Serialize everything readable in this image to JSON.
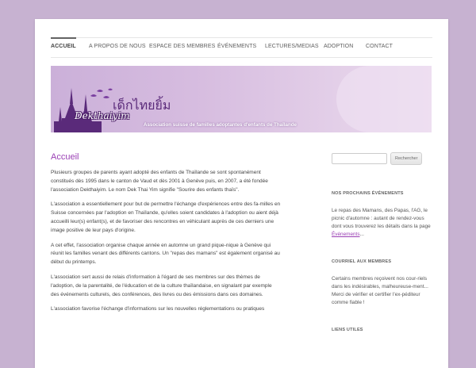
{
  "nav": {
    "items": [
      {
        "label": "ACCUEIL",
        "active": true
      },
      {
        "label": "A PROPOS DE NOUS"
      },
      {
        "label": "ESPACE DES MEMBRES"
      },
      {
        "label": "ÉVÉNEMENTS"
      },
      {
        "label": "LECTURES/MEDIAS"
      },
      {
        "label": "ADOPTION"
      },
      {
        "label": "CONTACT"
      }
    ]
  },
  "banner": {
    "logo_thai": "เด็กไทยยิ้ม",
    "logo_latin": "Dekthaiyim",
    "tagline": "Association suisse de familles adoptantes d'enfants de Thaïlande"
  },
  "main": {
    "title": "Accueil",
    "paragraphs": [
      "Plusieurs groupes de parents ayant adopté des enfants de Thaïlande se sont spontanément constitués dès 1995 dans le canton de Vaud et dès 2001 à Genève puis, en 2007, a été fondée l'association Dekthaiyim. Le nom Dek Thai Yim signifie \"Sourire des enfants thaïs\".",
      "L'association a essentiellement pour but de permettre l'échange d'expériences entre des fa-milles en Suisse concernées par l'adoption en Thaïlande, qu'elles soient candidates à l'adoption ou aient déjà accueilli leur(s) enfant(s), et de favoriser des rencontres en véhiculant auprès de ces derniers une image positive de leur pays d'origine.",
      "A cet effet, l'association organise chaque année en automne un grand pique-nique à Genève qui réunit les familles venant des différents cantons. Un \"repas des mamans\" est également organisé au début du printemps.",
      "L'association sert aussi de relais d'information à l'égard de ses membres sur des thèmes de l'adoption, de la parentalité, de l'éducation et de la culture thaïlandaise, en signalant par exemple des événements culturels, des conférences, des livres ou des émissions dans ces domaines.",
      "L'association favorise l'échange d'informations sur les nouvelles réglementations ou pratiques"
    ]
  },
  "sidebar": {
    "search": {
      "placeholder": "",
      "button_label": "Rechercher"
    },
    "widgets": [
      {
        "title": "NOS PROCHAINS ÉVÉNEMENTS",
        "text": "Le repas des Mamans, des Papas, l'AG, le picnic d'automne : autant de rendez-vous dont vous trouverez les détails dans la page ",
        "link": "Événements",
        "after": "..."
      },
      {
        "title": "COURRIEL AUX MEMBRES",
        "text": "Certains membres reçoivent nos cour-riels dans les indésirables, malheureuse-ment... Merci de vérifier et certifier l'ex-péditeur comme fiable !"
      },
      {
        "title": "LIENS UTILES"
      }
    ]
  },
  "colors": {
    "background": "#c7b2d1",
    "accent": "#9a3fb4",
    "banner": "#d7bde0"
  }
}
